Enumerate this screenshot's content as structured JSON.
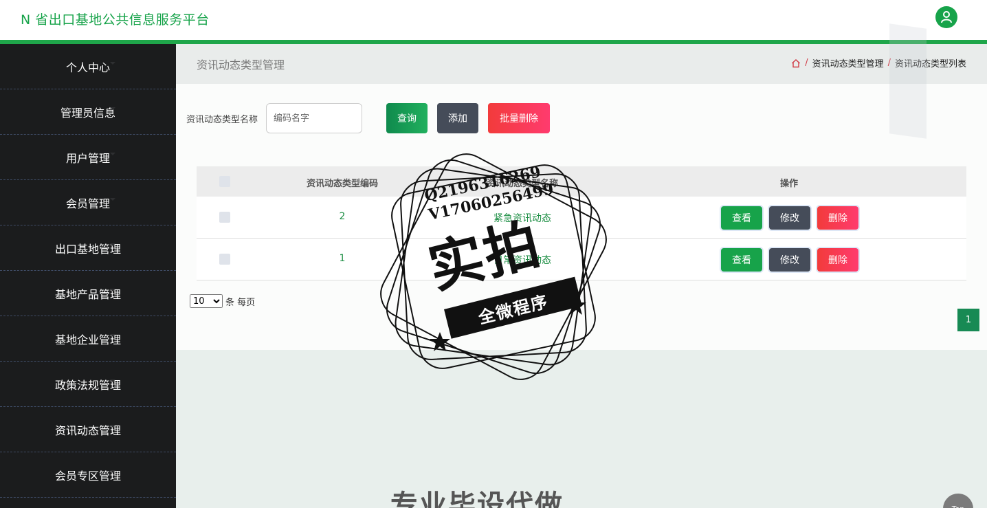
{
  "header": {
    "title": "N 省出口基地公共信息服务平台"
  },
  "sidebar": {
    "items": [
      {
        "label": "个人中心"
      },
      {
        "label": "管理员信息"
      },
      {
        "label": "用户管理"
      },
      {
        "label": "会员管理"
      },
      {
        "label": "出口基地管理"
      },
      {
        "label": "基地产品管理"
      },
      {
        "label": "基地企业管理"
      },
      {
        "label": "政策法规管理"
      },
      {
        "label": "资讯动态管理"
      },
      {
        "label": "会员专区管理"
      }
    ]
  },
  "main": {
    "page_title": "资讯动态类型管理",
    "breadcrumb": [
      "资讯动态类型管理",
      "资讯动态类型列表"
    ],
    "search": {
      "label": "资讯动态类型名称",
      "placeholder": "编码名字",
      "value": ""
    },
    "buttons": {
      "query": "查询",
      "add": "添加",
      "batch_delete": "批量删除"
    },
    "table": {
      "headers": [
        "资讯动态类型编码",
        "资讯动态类型名称",
        "操作"
      ],
      "rows": [
        {
          "code": "2",
          "name": "紧急资讯动态"
        },
        {
          "code": "1",
          "name": "日常资讯动态"
        }
      ],
      "row_actions": {
        "view": "查看",
        "edit": "修改",
        "delete": "删除"
      }
    },
    "pagination": {
      "page_size": "10",
      "page_size_options": [
        "10"
      ],
      "per_page_text": "条 每页",
      "current_page": "1"
    }
  },
  "overlay": {
    "stamp_line1": "Q2196316269",
    "stamp_line2": "V17060256499",
    "stamp_big": "实拍",
    "stamp_banner": "全微程序",
    "ghost_text": "专业毕设代做",
    "top_button": "Top"
  },
  "colors": {
    "brand_green": "#17a34a",
    "sidebar_bg": "#1b1c1d",
    "danger": "#f23b3b",
    "dark_button": "#454c59"
  }
}
